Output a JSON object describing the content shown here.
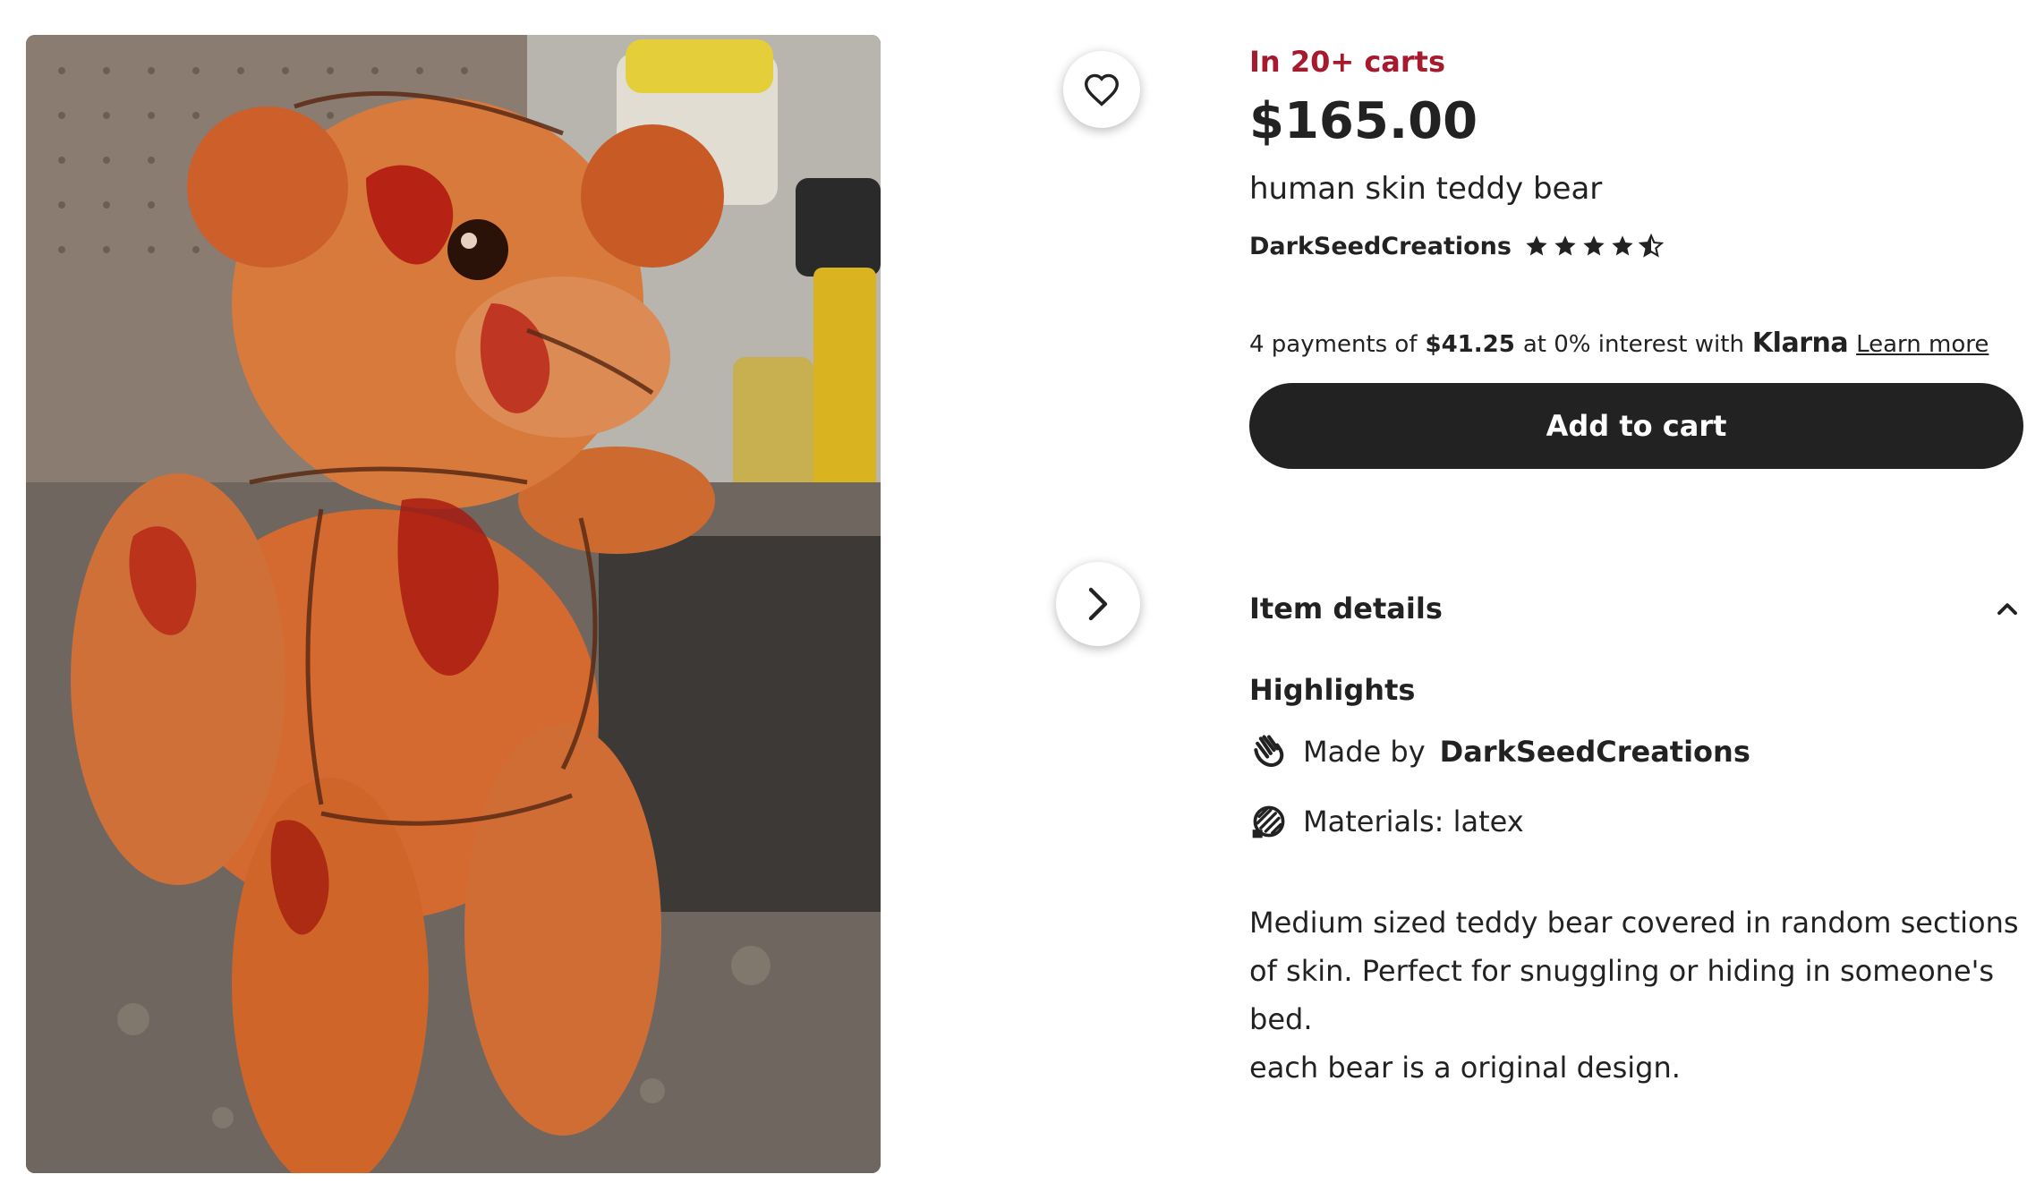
{
  "listing": {
    "cart_badge": "In 20+ carts",
    "price": "$165.00",
    "title": "human skin teddy bear",
    "seller": "DarkSeedCreations",
    "rating_stars": 4.5
  },
  "klarna": {
    "prefix": "4 payments of",
    "amount": "$41.25",
    "middle": "at 0% interest with",
    "brand": "Klarna",
    "link": "Learn more"
  },
  "actions": {
    "add_to_cart": "Add to cart"
  },
  "details": {
    "section_title": "Item details",
    "highlights_title": "Highlights",
    "made_by_label": "Made by",
    "made_by_name": "DarkSeedCreations",
    "materials": "Materials: latex"
  },
  "description": {
    "line1": "Medium sized teddy bear covered in random sections of skin. Perfect for snuggling or hiding in someone's bed.",
    "line2": "each bear is a original design."
  },
  "icons": {
    "favorite": "heart-icon",
    "next": "chevron-right-icon",
    "collapse": "chevron-up-icon",
    "made_by": "hand-wave-icon",
    "materials": "materials-icon",
    "rating": "star-icon"
  }
}
